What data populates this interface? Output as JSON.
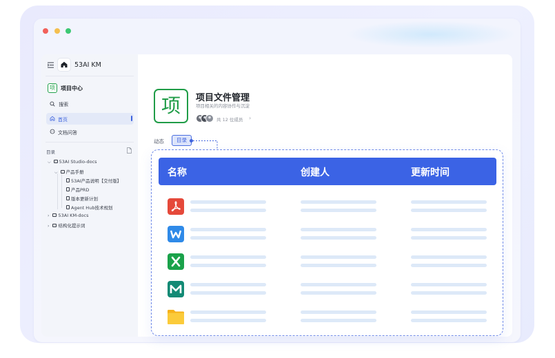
{
  "sidebar": {
    "brand": "53AI KM",
    "project_badge": "项",
    "project_title": "项目中心",
    "search_label": "搜索",
    "nav_home": "首页",
    "nav_qa": "文档问答",
    "directory_title": "目录",
    "tree": [
      {
        "label": "53AI Studio-docs"
      },
      {
        "label": "产品手册"
      },
      {
        "label": "53AI产品说明【交付版】"
      },
      {
        "label": "产品PRD"
      },
      {
        "label": "版本更新计划"
      },
      {
        "label": "Agent Hub技术规划"
      },
      {
        "label": "53AI KM-docs"
      },
      {
        "label": "结构化提示词"
      }
    ]
  },
  "main": {
    "badge": "项",
    "title": "项目文件管理",
    "subtitle": "项目相关的内容协作与沉淀",
    "members": "共 12 位成员",
    "tabs": [
      {
        "label": "动态"
      },
      {
        "label": "目录"
      }
    ],
    "table": {
      "headers": [
        "名称",
        "创建人",
        "更新时间"
      ],
      "rows": [
        {
          "icon": "pdf-icon",
          "color": "#e5493a"
        },
        {
          "icon": "wps-writer-icon",
          "color": "#2f8ae8"
        },
        {
          "icon": "excel-icon",
          "color": "#1aa24a"
        },
        {
          "icon": "markdown-icon",
          "color": "#128a75"
        },
        {
          "icon": "folder-icon",
          "color": "#f6b21b"
        }
      ]
    }
  },
  "colors": {
    "accent": "#3b63e5",
    "project_green": "#1f9c47"
  }
}
